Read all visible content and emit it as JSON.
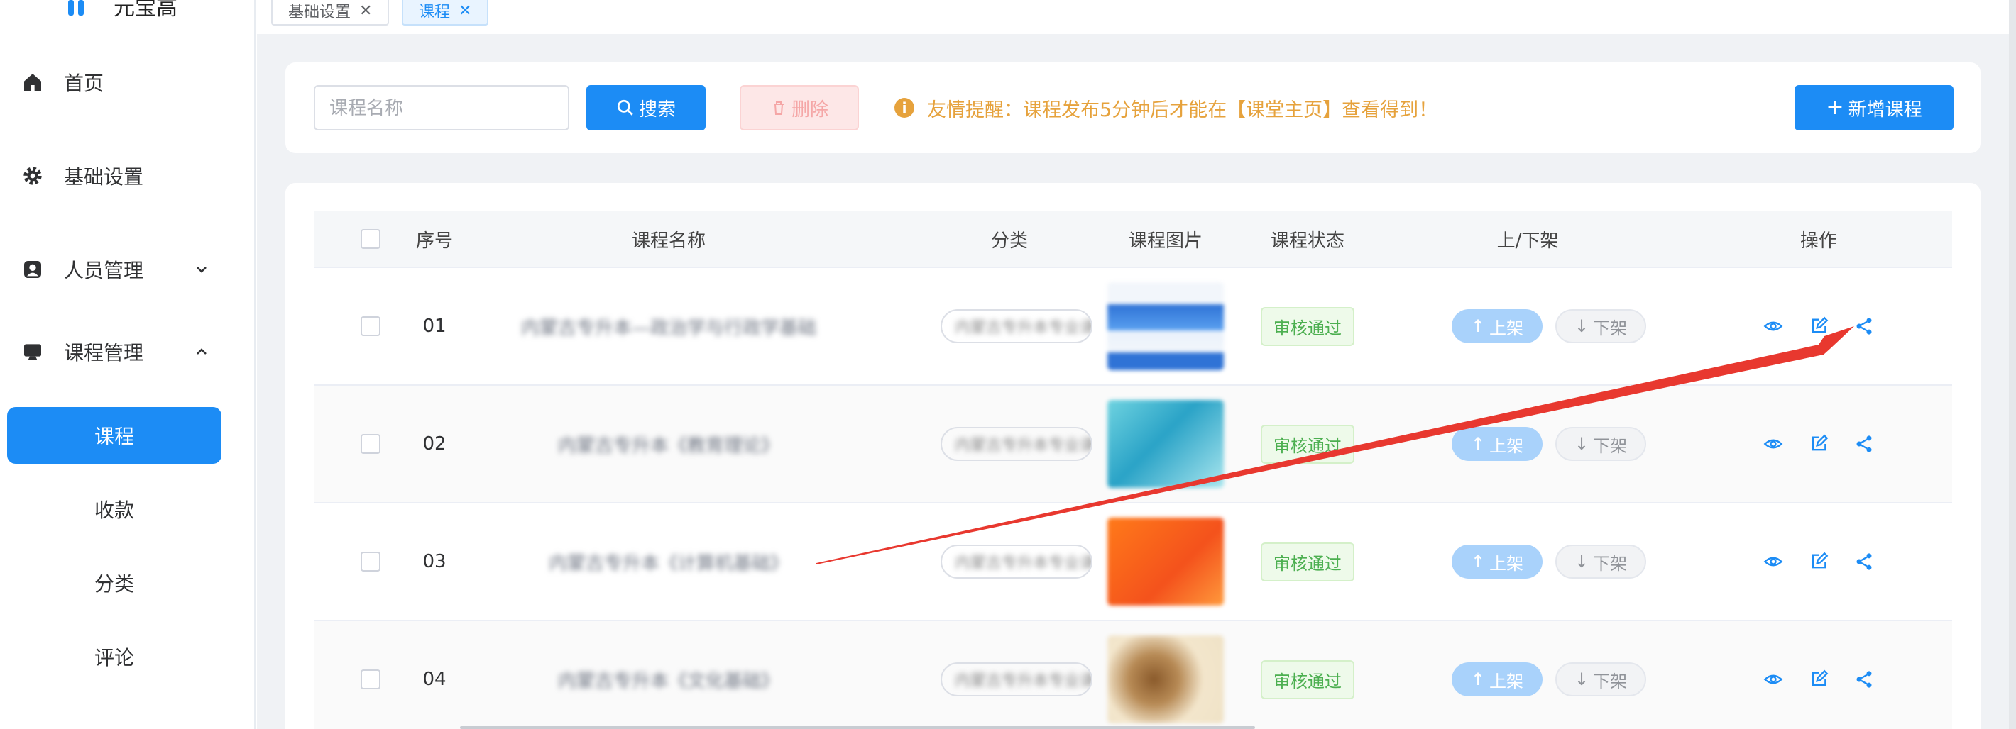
{
  "app": {
    "brand": "元宝高"
  },
  "sidebar": {
    "items": [
      {
        "label": "首页",
        "icon": "home-icon"
      },
      {
        "label": "基础设置",
        "icon": "gear-icon"
      },
      {
        "label": "人员管理",
        "icon": "user-icon"
      },
      {
        "label": "课程管理",
        "icon": "monitor-icon"
      }
    ],
    "sub_items": [
      {
        "label": "课程",
        "active": true
      },
      {
        "label": "收款"
      },
      {
        "label": "分类"
      },
      {
        "label": "评论"
      }
    ]
  },
  "tabs": [
    {
      "label": "基础设置",
      "active": false
    },
    {
      "label": "课程",
      "active": true
    }
  ],
  "toolbar": {
    "search_placeholder": "课程名称",
    "search_label": "搜索",
    "delete_label": "删除",
    "notice": "友情提醒：课程发布5分钟后才能在【课堂主页】查看得到！",
    "add_label": "新增课程"
  },
  "table": {
    "headers": [
      "序号",
      "课程名称",
      "分类",
      "课程图片",
      "课程状态",
      "上/下架",
      "操作"
    ],
    "rows": [
      {
        "index": "01",
        "name": "内蒙古专升本—政治学与行政学基础",
        "category": "内蒙古专升本专业课",
        "status": "审核通过",
        "up": "上架",
        "down": "下架",
        "thumb": "blue"
      },
      {
        "index": "02",
        "name": "内蒙古专升本《教育理论》",
        "category": "内蒙古专升本专业课",
        "status": "审核通过",
        "up": "上架",
        "down": "下架",
        "thumb": "teal"
      },
      {
        "index": "03",
        "name": "内蒙古专升本《计算机基础》",
        "category": "内蒙古专升本专业课",
        "status": "审核通过",
        "up": "上架",
        "down": "下架",
        "thumb": "orange"
      },
      {
        "index": "04",
        "name": "内蒙古专升本《文化基础》",
        "category": "内蒙古专升本专业课",
        "status": "审核通过",
        "up": "上架",
        "down": "下架",
        "thumb": "beige"
      }
    ]
  },
  "colors": {
    "primary": "#1c8cf5",
    "warning": "#e6a23c",
    "success": "#4caf50",
    "arrow": "#e8382f"
  }
}
